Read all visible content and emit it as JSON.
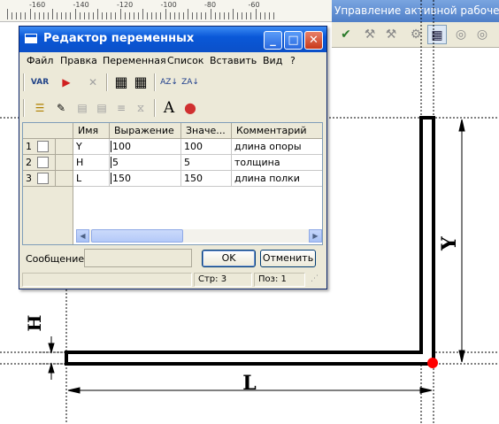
{
  "ruler": {
    "labels": [
      "-160",
      "-140",
      "-120",
      "-100",
      "-80",
      "-60"
    ]
  },
  "panel": {
    "title": "Управление активной рабочей п",
    "tool_icons": [
      "check-icon",
      "tool-1-icon",
      "tool-2-icon",
      "tool-3-icon",
      "variables-table-icon",
      "circle-1-icon",
      "circle-2-icon"
    ]
  },
  "dialog": {
    "title": "Редактор переменных",
    "menu": [
      "Файл",
      "Правка",
      "Переменная",
      "Список",
      "Вставить",
      "Вид",
      "?"
    ],
    "toolbar1": [
      {
        "icon": "var-icon",
        "label": "VAR"
      },
      {
        "icon": "flag-icon",
        "label": "▶"
      },
      {
        "icon": "delete-variable-icon",
        "label": "✕"
      },
      {
        "icon": "columns-a-icon",
        "label": "▦"
      },
      {
        "icon": "columns-b-icon",
        "label": "▦"
      },
      {
        "icon": "sort-az-icon",
        "label": "AZ↓"
      },
      {
        "icon": "sort-za-icon",
        "label": "ZA↓"
      }
    ],
    "toolbar2": [
      {
        "icon": "list-icon",
        "label": "☰"
      },
      {
        "icon": "edit-list-icon",
        "label": "✎"
      },
      {
        "icon": "grid-1-icon",
        "label": "▤"
      },
      {
        "icon": "grid-2-icon",
        "label": "▤"
      },
      {
        "icon": "align-icon",
        "label": "≡"
      },
      {
        "icon": "merge-icon",
        "label": "⧖"
      },
      {
        "icon": "font-icon",
        "label": "A"
      },
      {
        "icon": "colors-icon",
        "label": "●"
      }
    ],
    "table": {
      "headers": [
        "Имя",
        "Выражение",
        "Значе...",
        "Комментарий"
      ],
      "rows": [
        {
          "num": "1",
          "name": "Y",
          "expr": "100",
          "value": "100",
          "comment": "длина опоры"
        },
        {
          "num": "2",
          "name": "H",
          "expr": "5",
          "value": "5",
          "comment": "толщина"
        },
        {
          "num": "3",
          "name": "L",
          "expr": "150",
          "value": "150",
          "comment": "длина полки"
        }
      ]
    },
    "message_label": "Сообщение:",
    "ok_label": "OK",
    "cancel_label": "Отменить",
    "status": {
      "rows": "Стр:  3",
      "pos": "Поз:   1"
    }
  },
  "drawing": {
    "dims": {
      "y": "Y",
      "h": "H",
      "l": "L"
    },
    "colors": {
      "profile": "#000000",
      "base_point": "#ff0000"
    }
  }
}
